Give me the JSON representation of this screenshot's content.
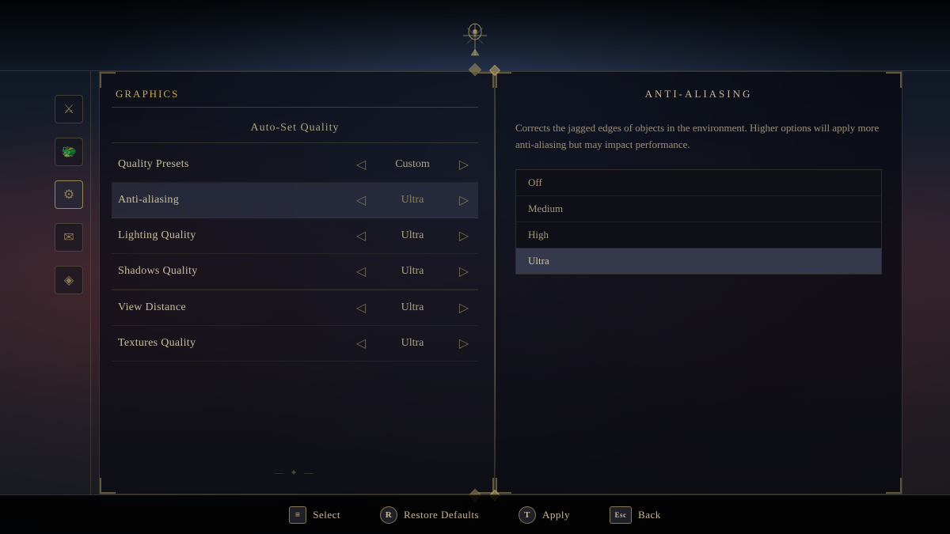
{
  "header": {
    "emblem": "✦"
  },
  "sidebar": {
    "icons": [
      {
        "name": "character-icon",
        "symbol": "⚔"
      },
      {
        "name": "inventory-icon",
        "symbol": "🐉"
      },
      {
        "name": "settings-icon",
        "symbol": "⚙"
      },
      {
        "name": "mail-icon",
        "symbol": "✉"
      },
      {
        "name": "map-icon",
        "symbol": "🗺"
      }
    ]
  },
  "settings": {
    "section_title": "GRAPHICS",
    "auto_set_label": "Auto-Set Quality",
    "rows": [
      {
        "name": "Quality Presets",
        "value": "Custom",
        "active": false
      },
      {
        "name": "Anti-aliasing",
        "value": "Ultra",
        "active": true
      },
      {
        "name": "Lighting Quality",
        "value": "Ultra",
        "active": false
      },
      {
        "name": "Shadows Quality",
        "value": "Ultra",
        "active": false
      },
      {
        "name": "View Distance",
        "value": "Ultra",
        "active": false
      },
      {
        "name": "Textures Quality",
        "value": "Ultra",
        "active": false
      }
    ]
  },
  "info_panel": {
    "title": "ANTI-ALIASING",
    "description": "Corrects the jagged edges of objects in the environment. Higher options will apply more anti-aliasing but may impact performance.",
    "options": [
      {
        "label": "Off",
        "selected": false
      },
      {
        "label": "Medium",
        "selected": false
      },
      {
        "label": "High",
        "selected": false
      },
      {
        "label": "Ultra",
        "selected": true
      }
    ]
  },
  "bottom_bar": {
    "actions": [
      {
        "key": "≡",
        "label": "Select",
        "circle": false
      },
      {
        "key": "R",
        "label": "Restore Defaults",
        "circle": true
      },
      {
        "key": "T",
        "label": "Apply",
        "circle": true
      },
      {
        "key": "Esc",
        "label": "Back",
        "circle": false
      }
    ]
  }
}
